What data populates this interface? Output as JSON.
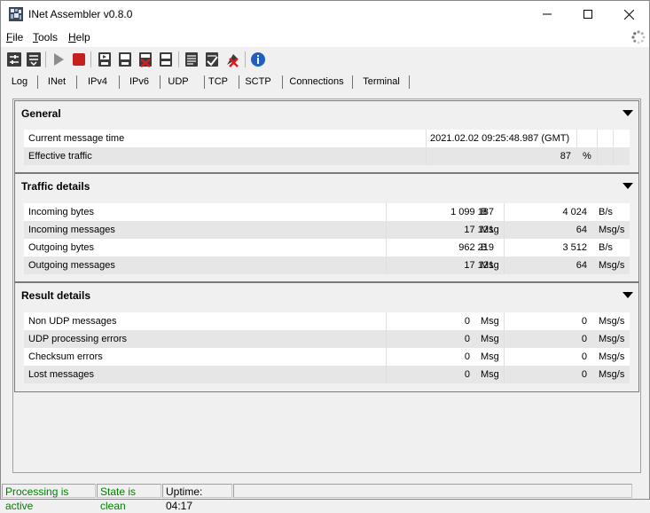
{
  "window": {
    "title": "INet Assembler v0.8.0"
  },
  "menu": {
    "file": {
      "accel": "F",
      "rest": "ile"
    },
    "tools": {
      "accel": "T",
      "rest": "ools"
    },
    "help": {
      "accel": "H",
      "rest": "elp"
    }
  },
  "toolbar": {
    "icons": [
      "settings-icon",
      "save-settings-icon",
      "play-icon",
      "stop-icon",
      "export-icon",
      "export-all-icon",
      "clear-icon",
      "import-icon",
      "log-icon",
      "log-check-icon",
      "log-clear-icon",
      "info-icon"
    ]
  },
  "tabs": [
    "Log",
    "INet",
    "IPv4",
    "IPv6",
    "UDP",
    "TCP",
    "SCTP",
    "Connections",
    "Terminal"
  ],
  "active_tab": "UDP",
  "general": {
    "title": "General",
    "rows": [
      {
        "label": "Current message time",
        "value": "2021.02.02 09:25:48.987 (GMT)",
        "unit": ""
      },
      {
        "label": "Effective traffic",
        "value": "87",
        "unit": "%"
      }
    ]
  },
  "traffic": {
    "title": "Traffic details",
    "rows": [
      {
        "label": "Incoming bytes",
        "value": "1 099 187",
        "unit": "B",
        "rate": "4 024",
        "rate_unit": "B/s"
      },
      {
        "label": "Incoming messages",
        "value": "17 121",
        "unit": "Msg",
        "rate": "64",
        "rate_unit": "Msg/s"
      },
      {
        "label": "Outgoing bytes",
        "value": "962 219",
        "unit": "B",
        "rate": "3 512",
        "rate_unit": "B/s"
      },
      {
        "label": "Outgoing messages",
        "value": "17 121",
        "unit": "Msg",
        "rate": "64",
        "rate_unit": "Msg/s"
      }
    ]
  },
  "result": {
    "title": "Result details",
    "rows": [
      {
        "label": "Non UDP messages",
        "value": "0",
        "unit": "Msg",
        "rate": "0",
        "rate_unit": "Msg/s"
      },
      {
        "label": "UDP processing errors",
        "value": "0",
        "unit": "Msg",
        "rate": "0",
        "rate_unit": "Msg/s"
      },
      {
        "label": "Checksum errors",
        "value": "0",
        "unit": "Msg",
        "rate": "0",
        "rate_unit": "Msg/s"
      },
      {
        "label": "Lost messages",
        "value": "0",
        "unit": "Msg",
        "rate": "0",
        "rate_unit": "Msg/s"
      }
    ]
  },
  "status": {
    "processing": "Processing is active",
    "state": "State is clean",
    "uptime": "Uptime: 04:17",
    "ok_color": "#008000"
  }
}
